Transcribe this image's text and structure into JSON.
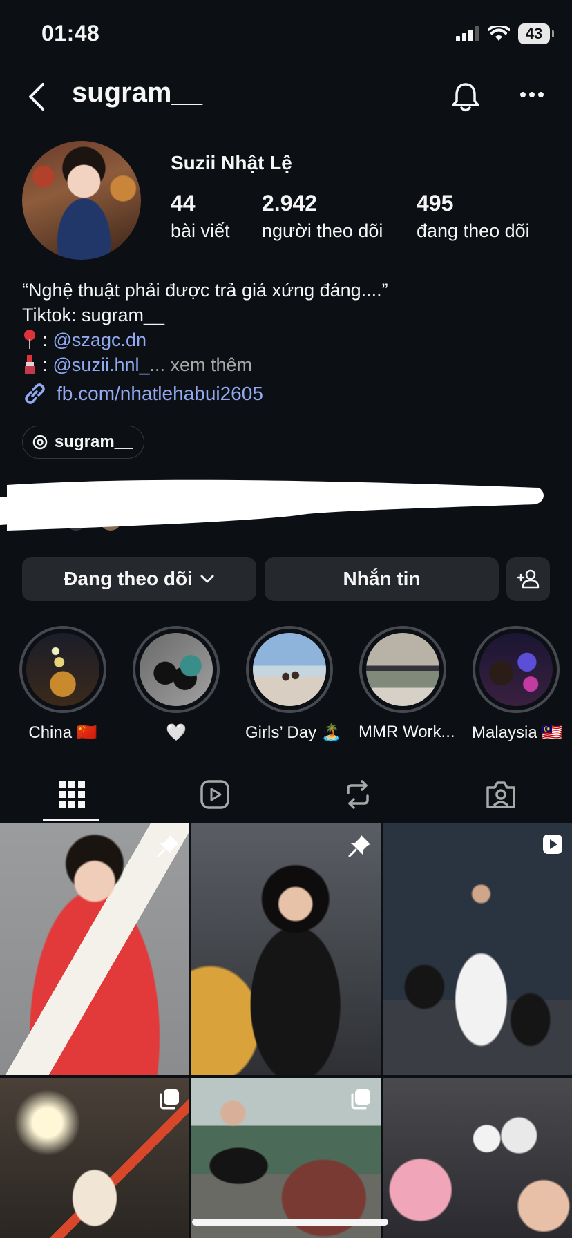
{
  "status_bar": {
    "time": "01:48",
    "battery": "43"
  },
  "header": {
    "username": "sugram__"
  },
  "profile": {
    "display_name": "Suzii Nhật Lệ",
    "stats": [
      {
        "value": "44",
        "label": "bài viết"
      },
      {
        "value": "2.942",
        "label": "người theo dõi"
      },
      {
        "value": "495",
        "label": "đang theo dõi"
      }
    ],
    "bio": {
      "line1": "“Nghệ thuật phải được trả giá xứng đáng....”",
      "line2": "Tiktok: sugram__",
      "line3_prefix": " : ",
      "line3_handle": "@szagc.dn",
      "line4_prefix": " : ",
      "line4_handle": "@suzii.hnl_",
      "line4_more": "... xem thêm"
    },
    "external_link": "fb.com/nhatlehabui2605",
    "threads_handle": "sugram__"
  },
  "actions": {
    "following_label": "Đang theo dõi",
    "message_label": "Nhắn tin"
  },
  "highlights": [
    {
      "label": "China 🇨🇳"
    },
    {
      "label": "🤍"
    },
    {
      "label": "Girls’ Day 🏝️"
    },
    {
      "label": "MMR Work..."
    },
    {
      "label": "Malaysia 🇲🇾"
    }
  ],
  "tabs": [
    "grid-icon",
    "reels-icon",
    "reposts-icon",
    "tagged-icon"
  ],
  "grid_badges": [
    "pin-icon",
    "pin-icon",
    "video-icon",
    "carousel-icon",
    "carousel-icon",
    "none"
  ]
}
